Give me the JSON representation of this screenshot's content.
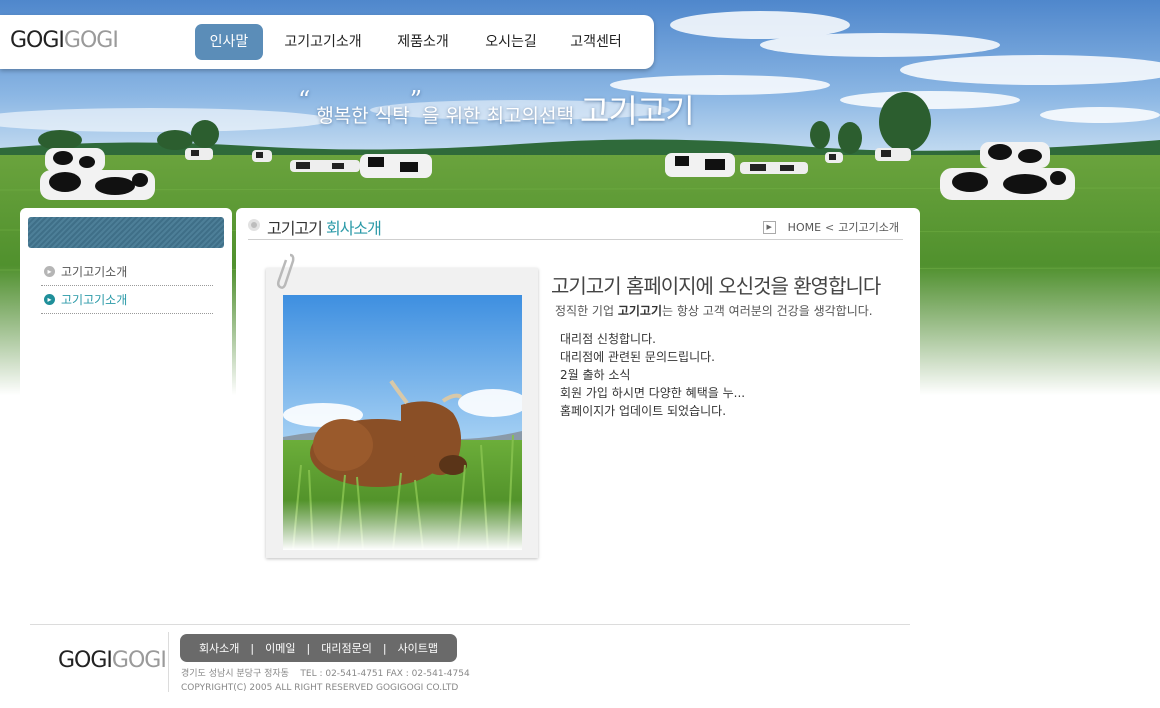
{
  "logo": {
    "part1": "GOGI",
    "part2": "GOGI"
  },
  "nav": [
    {
      "label": "인사말",
      "active": true
    },
    {
      "label": "고기고기소개",
      "active": false
    },
    {
      "label": "제품소개",
      "active": false
    },
    {
      "label": "오시는길",
      "active": false
    },
    {
      "label": "고객센터",
      "active": false
    }
  ],
  "hero": {
    "quote_open": "“",
    "slogan_a": " 행복한 식탁",
    "quote_close": "”",
    "slogan_b": "을 위한 최고의선택",
    "brand": "고기고기"
  },
  "sidebar": {
    "items": [
      {
        "label": "고기고기소개",
        "active": false
      },
      {
        "label": "고기고기소개",
        "active": true
      }
    ]
  },
  "content": {
    "title_a": "고기고기",
    "title_b": "회사소개",
    "breadcrumb": {
      "home": "HOME",
      "sep": "<",
      "current": "고기고기소개"
    },
    "welcome": "고기고기 홈페이지에 오신것을 환영합니다",
    "sub_a": "정직한 기업 ",
    "sub_brand": "고기고기",
    "sub_b": "는 항상 고객 여러분의 건강을 생각합니다.",
    "news": [
      "대리점 신청합니다.",
      "대리점에 관련된 문의드립니다.",
      "2월 출하 소식",
      "회원 가입 하시면 다양한 혜택을 누...",
      "홈페이지가 업데이트 되었습니다."
    ]
  },
  "footer": {
    "logo": {
      "part1": "GOGI",
      "part2": "GOGI"
    },
    "menu": [
      "회사소개",
      "이메일",
      "대리점문의",
      "사이트맵"
    ],
    "menu_sep": "|",
    "address": "경기도 성남시 분당구 정자동",
    "phone": "TEL : 02-541-4751  FAX : 02-541-4754",
    "copyright": "COPYRIGHT(C) 2005 ALL RIGHT RESERVED GOGIGOGI  CO.LTD"
  },
  "colors": {
    "nav_active": "#5b8db8",
    "accent": "#2b9aa8",
    "sky": "#6c9fd6",
    "grass": "#4e8f2c",
    "footer_menu": "#6a6a6a"
  }
}
